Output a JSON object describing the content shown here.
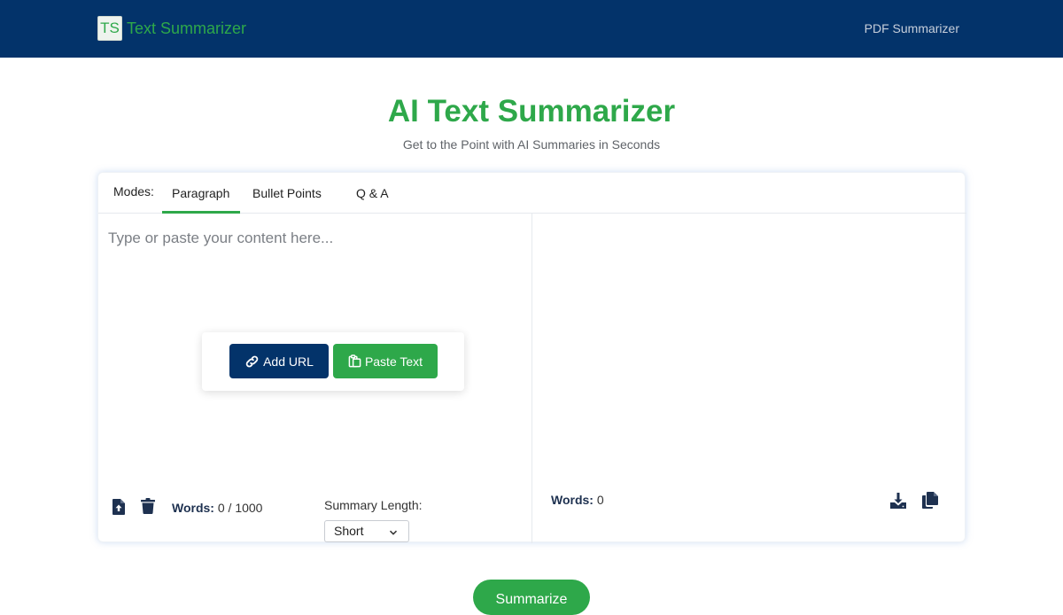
{
  "header": {
    "logo_text": "TS",
    "brand": "Text Summarizer",
    "nav_link": "PDF Summarizer"
  },
  "hero": {
    "title": "AI Text Summarizer",
    "subtitle": "Get to the Point with AI Summaries in Seconds"
  },
  "modes": {
    "label": "Modes:",
    "tabs": [
      {
        "label": "Paragraph",
        "active": true
      },
      {
        "label": "Bullet Points",
        "active": false
      },
      {
        "label": "Q & A",
        "active": false
      }
    ]
  },
  "input": {
    "placeholder": "Type or paste your content here...",
    "value": "",
    "add_url_label": "Add URL",
    "paste_text_label": "Paste Text",
    "words_label": "Words:",
    "words_count": "0 / 1000"
  },
  "summary_length": {
    "label": "Summary Length:",
    "selected": "Short"
  },
  "output": {
    "words_label": "Words:",
    "words_count": "0"
  },
  "summarize_label": "Summarize",
  "colors": {
    "navy": "#03336a",
    "green": "#2ea84a"
  },
  "icons": [
    "link-icon",
    "clipboard-icon",
    "file-upload-icon",
    "trash-icon",
    "chevron-down-icon",
    "download-icon",
    "copy-icon"
  ]
}
